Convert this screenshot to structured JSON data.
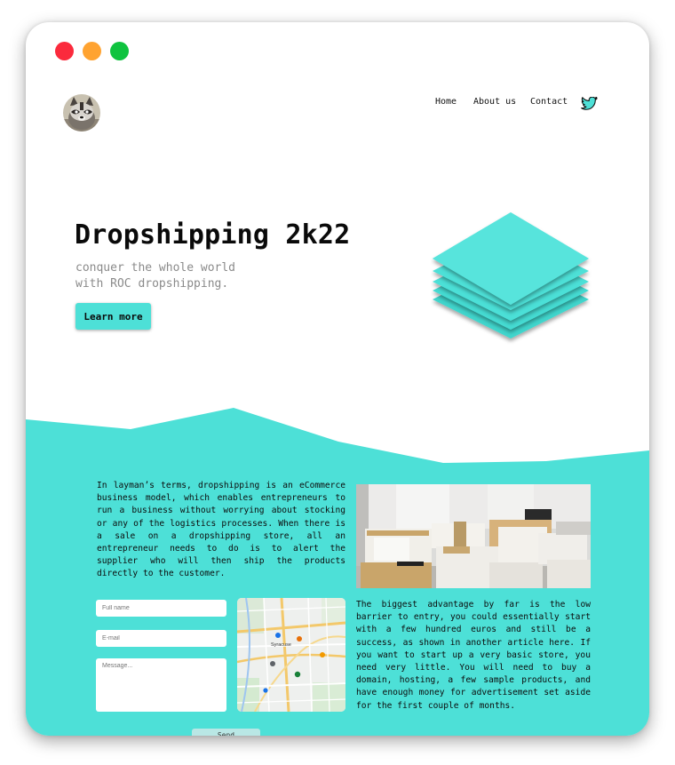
{
  "colors": {
    "accent": "#4de0d7",
    "accent_dark": "#2fc9be",
    "red": "#fb2a3c",
    "yellow": "#ffa331",
    "green": "#0fc33f"
  },
  "nav": {
    "home": "Home",
    "about": "About us",
    "contact": "Contact",
    "social_icon": "twitter-icon"
  },
  "hero": {
    "title": "Dropshipping 2k22",
    "subtitle_line1": "conquer the whole world",
    "subtitle_line2": "with ROC dropshipping.",
    "button": "Learn more"
  },
  "content": {
    "paragraph1": "In layman’s terms, dropshipping is an eCommerce business model, which enables entrepreneurs to run a business without worrying about stocking or any of the logistics processes. When there is a sale on a dropshipping store, all an entrepreneur needs to do is to alert the supplier who will then ship the products directly to the customer.",
    "paragraph2": "The biggest advantage by far is the low barrier to entry, you could essentially start with a few hundred euros and still be a success, as shown in another article here. If you want to start up a very basic store, you need very little. You will need to buy a domain, hosting, a few sample products, and have enough money for advertisement set aside for the first couple of months."
  },
  "form": {
    "name_placeholder": "Full name",
    "email_placeholder": "E-mail",
    "message_placeholder": "Message...",
    "send": "Send"
  },
  "map": {
    "city_label": "Syracuse"
  }
}
